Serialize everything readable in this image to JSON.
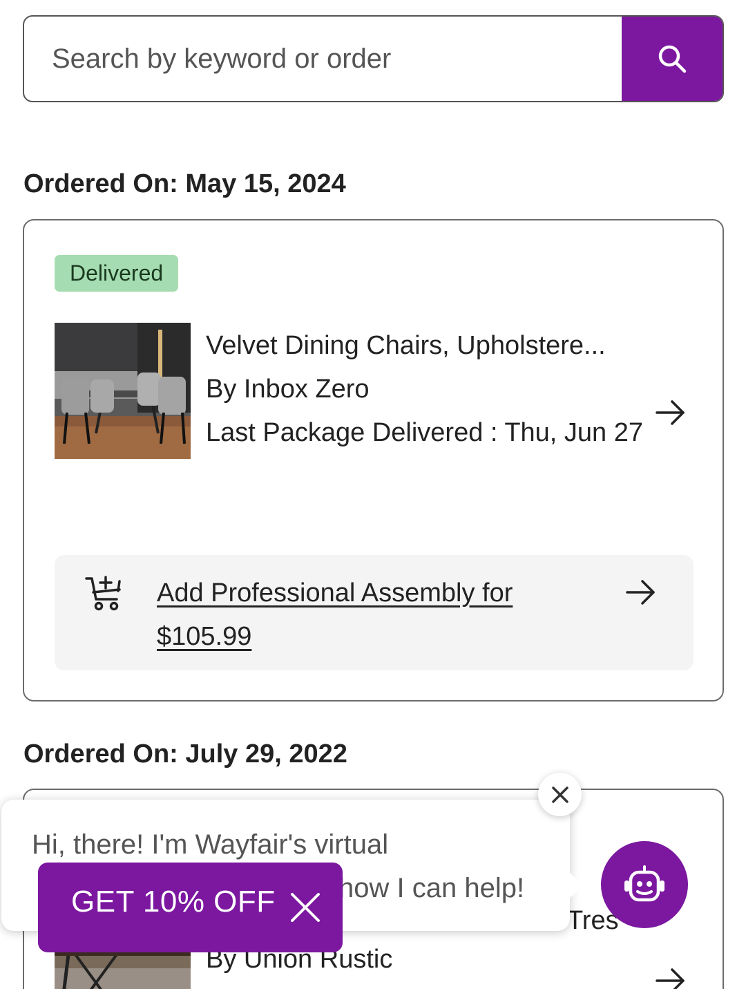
{
  "search": {
    "placeholder": "Search by keyword or order"
  },
  "orders": [
    {
      "date_label": "Ordered On: May 15, 2024",
      "status": "Delivered",
      "item": {
        "title": "Velvet Dining Chairs, Upholstere...",
        "brand": "By Inbox Zero",
        "delivery": "Last Package Delivered : Thu, Jun 27"
      },
      "assembly_link": "Add Professional Assembly for $105.99"
    },
    {
      "date_label": "Ordered On: July 29, 2022",
      "item": {
        "title_fragment": "Tres",
        "brand": "By Union Rustic"
      }
    }
  ],
  "chat": {
    "line1": "Hi, there! I'm Wayfair's virtual",
    "line2": "how I can help!"
  },
  "promo": {
    "label": "GET 10% OFF"
  },
  "colors": {
    "brand_purple": "#7b189f",
    "delivered_badge": "#a6dcb1",
    "assembly_bg": "#f4f4f4"
  },
  "icons": [
    "search-icon",
    "arrow-right-icon",
    "cart-plus-icon",
    "close-icon",
    "chatbot-icon"
  ]
}
